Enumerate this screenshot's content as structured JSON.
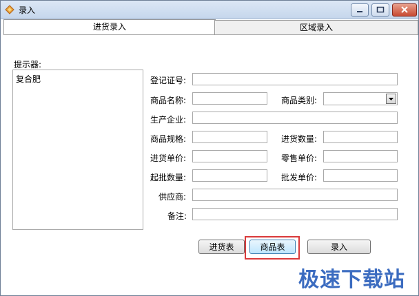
{
  "window": {
    "title": "录入",
    "app_icon": "diamond-app-icon"
  },
  "tabs": [
    {
      "label": "进货录入",
      "active": true
    },
    {
      "label": "区域录入",
      "active": false
    }
  ],
  "hint": {
    "label": "提示器:",
    "items": [
      "复合肥"
    ]
  },
  "form": {
    "registration_no": {
      "label": "登记证号:",
      "value": ""
    },
    "product_name": {
      "label": "商品名称:",
      "value": ""
    },
    "product_category": {
      "label": "商品类别:",
      "value": ""
    },
    "manufacturer": {
      "label": "生产企业:",
      "value": ""
    },
    "product_spec": {
      "label": "商品规格:",
      "value": ""
    },
    "purchase_qty": {
      "label": "进货数量:",
      "value": ""
    },
    "purchase_price": {
      "label": "进货单价:",
      "value": ""
    },
    "retail_price": {
      "label": "零售单价:",
      "value": ""
    },
    "min_batch_qty": {
      "label": "起批数量:",
      "value": ""
    },
    "wholesale_price": {
      "label": "批发单价:",
      "value": ""
    },
    "supplier": {
      "label": "供应商:",
      "value": ""
    },
    "remarks": {
      "label": "备注:",
      "value": ""
    }
  },
  "buttons": {
    "purchase_table": "进货表",
    "product_table": "商品表",
    "enter": "录入"
  },
  "watermark": "极速下载站",
  "colors": {
    "highlight": "#d9393a",
    "watermark": "#3c6cc0"
  }
}
